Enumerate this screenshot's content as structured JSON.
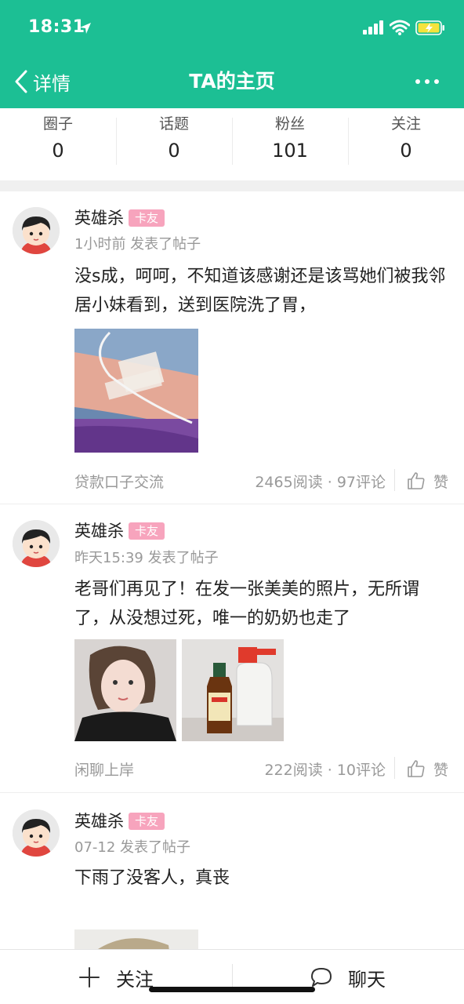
{
  "status_bar": {
    "time": "18:31"
  },
  "nav": {
    "back_label": "详情",
    "title": "TA的主页"
  },
  "stats": [
    {
      "label": "圈子",
      "value": "0"
    },
    {
      "label": "话题",
      "value": "0"
    },
    {
      "label": "粉丝",
      "value": "101"
    },
    {
      "label": "关注",
      "value": "0"
    }
  ],
  "posts": [
    {
      "author": "英雄杀",
      "badge": "卡友",
      "meta": "1小时前 发表了帖子",
      "content": "没s成，呵呵，不知道该感谢还是该骂她们被我邻居小妹看到，送到医院洗了胃，",
      "tag": "贷款口子交流",
      "counts": "2465阅读 · 97评论",
      "like_label": "赞"
    },
    {
      "author": "英雄杀",
      "badge": "卡友",
      "meta": "昨天15:39 发表了帖子",
      "content": "老哥们再见了！在发一张美美的照片，无所谓了，从没想过死，唯一的奶奶也走了",
      "tag": "闲聊上岸",
      "counts": "222阅读 · 10评论",
      "like_label": "赞"
    },
    {
      "author": "英雄杀",
      "badge": "卡友",
      "meta": "07-12 发表了帖子",
      "content": "下雨了没客人，真丧"
    }
  ],
  "bottom_bar": {
    "follow_label": "关注",
    "chat_label": "聊天"
  },
  "colors": {
    "accent": "#1cbf94",
    "badge": "#f7a4bd",
    "muted_text": "#999999"
  },
  "icons": [
    "location-arrow-icon",
    "signal-icon",
    "wifi-icon",
    "battery-icon",
    "back-chevron-icon",
    "more-icon",
    "thumbs-up-icon",
    "plus-icon",
    "chat-bubble-icon"
  ]
}
